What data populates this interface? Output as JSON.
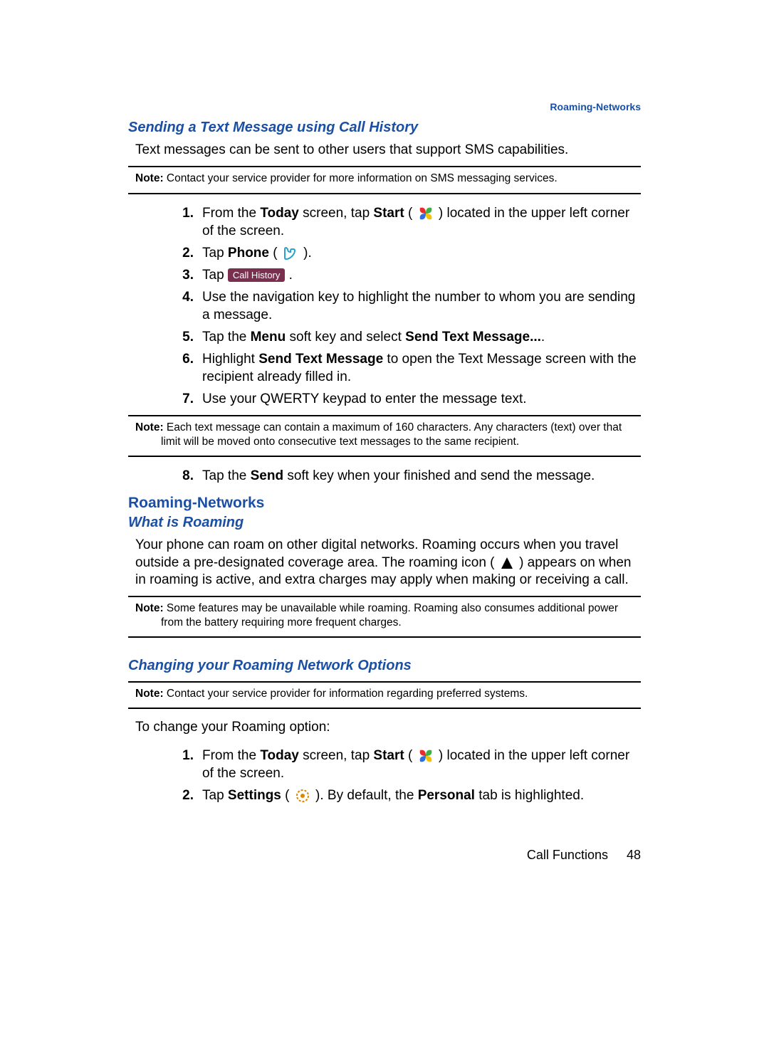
{
  "header_link": "Roaming-Networks",
  "section1": {
    "title": "Sending a Text Message using Call History",
    "intro": "Text messages can be sent to other users that support SMS capabilities.",
    "note1_label": "Note:",
    "note1_text": " Contact your service provider for more information on SMS messaging services.",
    "steps": {
      "s1_num": "1.",
      "s1_a": "From the ",
      "s1_b": "Today",
      "s1_c": " screen, tap ",
      "s1_d": "Start",
      "s1_e": " ( ",
      "s1_f": " ) located in the upper left corner of the screen.",
      "s2_num": "2.",
      "s2_a": "Tap ",
      "s2_b": "Phone",
      "s2_c": " ( ",
      "s2_d": " ).",
      "s3_num": "3.",
      "s3_a": "Tap ",
      "s3_btn": "Call History",
      "s3_b": " .",
      "s4_num": "4.",
      "s4_a": "Use the navigation key to highlight the number to whom you are sending a message.",
      "s5_num": "5.",
      "s5_a": "Tap the ",
      "s5_b": "Menu",
      "s5_c": " soft key and select ",
      "s5_d": "Send Text Message...",
      "s5_e": ".",
      "s6_num": "6.",
      "s6_a": "Highlight ",
      "s6_b": "Send Text Message",
      "s6_c": " to open the Text Message screen with the recipient already filled in.",
      "s7_num": "7.",
      "s7_a": "Use your QWERTY keypad to enter the message text."
    },
    "note2_label": "Note:",
    "note2_text": " Each text message can contain a maximum of 160 characters. Any characters (text) over that limit will be moved onto consecutive text messages to the same recipient.",
    "s8_num": "8.",
    "s8_a": "Tap the ",
    "s8_b": "Send",
    "s8_c": " soft key when your finished and send the message."
  },
  "section2": {
    "title": "Roaming-Networks",
    "sub1": "What is Roaming",
    "p1a": "Your phone can roam on other digital networks. Roaming occurs when you travel outside a pre-designated coverage area. The roaming icon ( ",
    "p1b": " ) appears on when in roaming is active, and extra charges may apply when making or receiving a call.",
    "note3_label": "Note:",
    "note3_text": " Some features may be unavailable while roaming. Roaming also consumes additional power from the battery requiring more frequent charges.",
    "sub2": "Changing your Roaming Network Options",
    "note4_label": "Note:",
    "note4_text": " Contact your service provider for information regarding preferred systems.",
    "p2": "To change your Roaming option:",
    "steps2": {
      "s1_num": "1.",
      "s1_a": "From the ",
      "s1_b": "Today",
      "s1_c": " screen, tap ",
      "s1_d": "Start",
      "s1_e": " ( ",
      "s1_f": " ) located in the upper left corner of the screen.",
      "s2_num": "2.",
      "s2_a": "Tap ",
      "s2_b": "Settings",
      "s2_c": " ( ",
      "s2_d": " ). By default, the ",
      "s2_e": "Personal",
      "s2_f": " tab is highlighted."
    }
  },
  "footer": {
    "chapter": "Call Functions",
    "page": "48"
  }
}
